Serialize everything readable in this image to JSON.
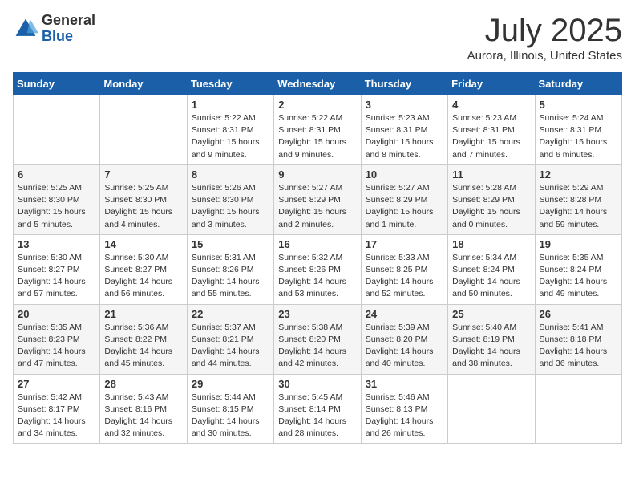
{
  "header": {
    "logo_line1": "General",
    "logo_line2": "Blue",
    "title": "July 2025",
    "location": "Aurora, Illinois, United States"
  },
  "weekdays": [
    "Sunday",
    "Monday",
    "Tuesday",
    "Wednesday",
    "Thursday",
    "Friday",
    "Saturday"
  ],
  "weeks": [
    [
      null,
      null,
      {
        "day": 1,
        "sunrise": "5:22 AM",
        "sunset": "8:31 PM",
        "daylight": "15 hours and 9 minutes."
      },
      {
        "day": 2,
        "sunrise": "5:22 AM",
        "sunset": "8:31 PM",
        "daylight": "15 hours and 9 minutes."
      },
      {
        "day": 3,
        "sunrise": "5:23 AM",
        "sunset": "8:31 PM",
        "daylight": "15 hours and 8 minutes."
      },
      {
        "day": 4,
        "sunrise": "5:23 AM",
        "sunset": "8:31 PM",
        "daylight": "15 hours and 7 minutes."
      },
      {
        "day": 5,
        "sunrise": "5:24 AM",
        "sunset": "8:31 PM",
        "daylight": "15 hours and 6 minutes."
      }
    ],
    [
      {
        "day": 6,
        "sunrise": "5:25 AM",
        "sunset": "8:30 PM",
        "daylight": "15 hours and 5 minutes."
      },
      {
        "day": 7,
        "sunrise": "5:25 AM",
        "sunset": "8:30 PM",
        "daylight": "15 hours and 4 minutes."
      },
      {
        "day": 8,
        "sunrise": "5:26 AM",
        "sunset": "8:30 PM",
        "daylight": "15 hours and 3 minutes."
      },
      {
        "day": 9,
        "sunrise": "5:27 AM",
        "sunset": "8:29 PM",
        "daylight": "15 hours and 2 minutes."
      },
      {
        "day": 10,
        "sunrise": "5:27 AM",
        "sunset": "8:29 PM",
        "daylight": "15 hours and 1 minute."
      },
      {
        "day": 11,
        "sunrise": "5:28 AM",
        "sunset": "8:29 PM",
        "daylight": "15 hours and 0 minutes."
      },
      {
        "day": 12,
        "sunrise": "5:29 AM",
        "sunset": "8:28 PM",
        "daylight": "14 hours and 59 minutes."
      }
    ],
    [
      {
        "day": 13,
        "sunrise": "5:30 AM",
        "sunset": "8:27 PM",
        "daylight": "14 hours and 57 minutes."
      },
      {
        "day": 14,
        "sunrise": "5:30 AM",
        "sunset": "8:27 PM",
        "daylight": "14 hours and 56 minutes."
      },
      {
        "day": 15,
        "sunrise": "5:31 AM",
        "sunset": "8:26 PM",
        "daylight": "14 hours and 55 minutes."
      },
      {
        "day": 16,
        "sunrise": "5:32 AM",
        "sunset": "8:26 PM",
        "daylight": "14 hours and 53 minutes."
      },
      {
        "day": 17,
        "sunrise": "5:33 AM",
        "sunset": "8:25 PM",
        "daylight": "14 hours and 52 minutes."
      },
      {
        "day": 18,
        "sunrise": "5:34 AM",
        "sunset": "8:24 PM",
        "daylight": "14 hours and 50 minutes."
      },
      {
        "day": 19,
        "sunrise": "5:35 AM",
        "sunset": "8:24 PM",
        "daylight": "14 hours and 49 minutes."
      }
    ],
    [
      {
        "day": 20,
        "sunrise": "5:35 AM",
        "sunset": "8:23 PM",
        "daylight": "14 hours and 47 minutes."
      },
      {
        "day": 21,
        "sunrise": "5:36 AM",
        "sunset": "8:22 PM",
        "daylight": "14 hours and 45 minutes."
      },
      {
        "day": 22,
        "sunrise": "5:37 AM",
        "sunset": "8:21 PM",
        "daylight": "14 hours and 44 minutes."
      },
      {
        "day": 23,
        "sunrise": "5:38 AM",
        "sunset": "8:20 PM",
        "daylight": "14 hours and 42 minutes."
      },
      {
        "day": 24,
        "sunrise": "5:39 AM",
        "sunset": "8:20 PM",
        "daylight": "14 hours and 40 minutes."
      },
      {
        "day": 25,
        "sunrise": "5:40 AM",
        "sunset": "8:19 PM",
        "daylight": "14 hours and 38 minutes."
      },
      {
        "day": 26,
        "sunrise": "5:41 AM",
        "sunset": "8:18 PM",
        "daylight": "14 hours and 36 minutes."
      }
    ],
    [
      {
        "day": 27,
        "sunrise": "5:42 AM",
        "sunset": "8:17 PM",
        "daylight": "14 hours and 34 minutes."
      },
      {
        "day": 28,
        "sunrise": "5:43 AM",
        "sunset": "8:16 PM",
        "daylight": "14 hours and 32 minutes."
      },
      {
        "day": 29,
        "sunrise": "5:44 AM",
        "sunset": "8:15 PM",
        "daylight": "14 hours and 30 minutes."
      },
      {
        "day": 30,
        "sunrise": "5:45 AM",
        "sunset": "8:14 PM",
        "daylight": "14 hours and 28 minutes."
      },
      {
        "day": 31,
        "sunrise": "5:46 AM",
        "sunset": "8:13 PM",
        "daylight": "14 hours and 26 minutes."
      },
      null,
      null
    ]
  ],
  "accent_color": "#1a5fa8"
}
